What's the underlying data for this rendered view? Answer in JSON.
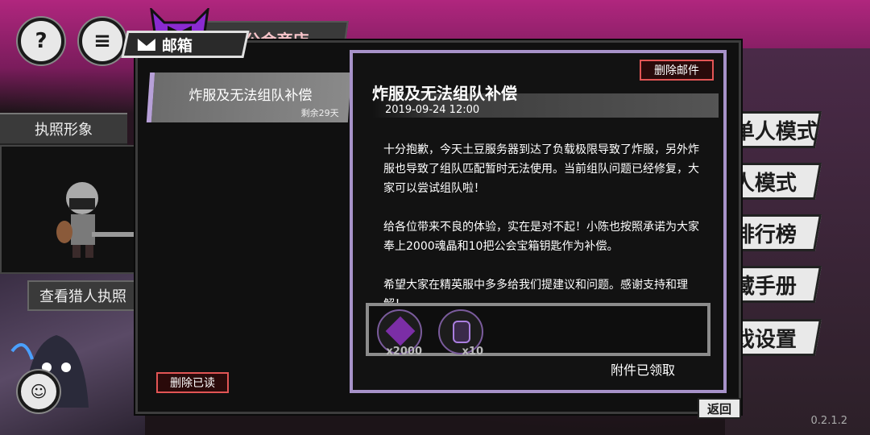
{
  "background": {
    "shop_tab_label": "公会商店",
    "license_label": "执照形象",
    "view_license_label": "查看猎人执照",
    "side_menu": [
      "单人模式",
      "人模式",
      "排行榜",
      "藏手册",
      "戏设置"
    ]
  },
  "mailbox": {
    "title": "邮箱",
    "mail_list": [
      {
        "subject": "炸服及无法组队补偿",
        "remaining": "剩余29天"
      }
    ],
    "delete_read_label": "删除已读",
    "detail": {
      "title": "炸服及无法组队补偿",
      "date": "2019-09-24 12:00",
      "delete_label": "删除邮件",
      "paragraphs": [
        "十分抱歉，今天土豆服务器到达了负载极限导致了炸服，另外炸服也导致了组队匹配暂时无法使用。当前组队问题已经修复，大家可以尝试组队啦！",
        "给各位带来不良的体验，实在是对不起！小陈也按照承诺为大家奉上2000魂晶和10把公会宝箱钥匙作为补偿。",
        "希望大家在精英服中多多给我们提建议和问题。感谢支持和理解！"
      ],
      "attachments": [
        {
          "icon": "soul-crystal-icon",
          "qty": "x2000"
        },
        {
          "icon": "guild-chest-key-icon",
          "qty": "x10"
        }
      ],
      "claimed_label": "附件已领取"
    }
  },
  "back_label": "返回",
  "version": "0.2.1.2",
  "colors": {
    "accent_purple": "#a792c9",
    "danger_red": "#e25555",
    "magenta": "#b0267e"
  }
}
